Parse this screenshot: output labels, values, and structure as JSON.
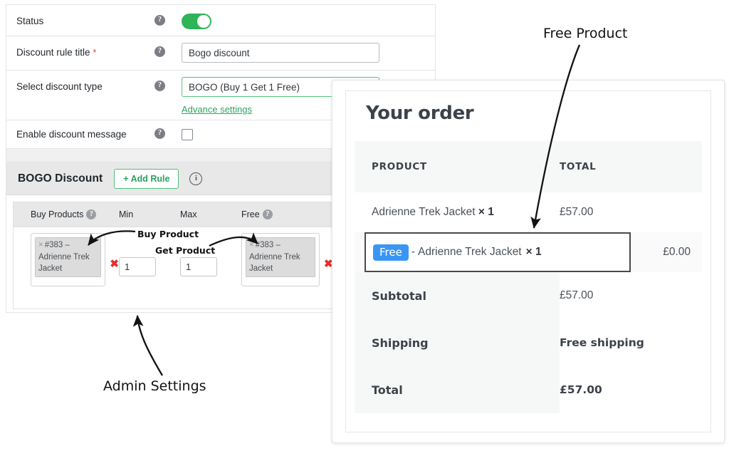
{
  "admin_form": {
    "rows": [
      {
        "label": "Status",
        "help": "?",
        "control": "toggle",
        "toggle_on": true
      },
      {
        "label": "Discount rule title",
        "required": true,
        "help": "?",
        "control": "text",
        "value": "Bogo discount"
      },
      {
        "label": "Select discount type",
        "help": "?",
        "control": "select",
        "value": "BOGO (Buy 1 Get 1 Free)",
        "link": "Advance settings"
      },
      {
        "label": "Enable discount message",
        "help": "?",
        "control": "checkbox",
        "checked": false
      }
    ]
  },
  "bogo": {
    "section_title": "BOGO Discount",
    "add_rule_label": "+ Add Rule",
    "info_icon": "info-icon",
    "columns": [
      "Buy Products",
      "Min",
      "Max",
      "Free"
    ],
    "rule": {
      "buy_product_tag": "#383 – Adrienne Trek Jacket",
      "buy_product_id": "#383 –",
      "buy_product_name": "Adrienne Trek Jacket",
      "min": "1",
      "max": "1",
      "free_product_id": "#383 –",
      "free_product_name": "Adrienne Trek Jacket",
      "remove_label": "✖"
    }
  },
  "order": {
    "title": "Your order",
    "columns": {
      "product": "PRODUCT",
      "total": "TOTAL"
    },
    "lines": [
      {
        "name": "Adrienne Trek Jacket",
        "qty": "× 1",
        "total": "£57.00",
        "free": false
      },
      {
        "badge": "Free",
        "prefix": "-",
        "name": "Adrienne Trek Jacket",
        "qty": "× 1",
        "total": "£0.00",
        "free": true
      }
    ],
    "totals": [
      {
        "label": "Subtotal",
        "value": "£57.00",
        "bold": false
      },
      {
        "label": "Shipping",
        "value": "Free shipping",
        "bold": true
      },
      {
        "label": "Total",
        "value": "£57.00",
        "bold": true
      }
    ]
  },
  "annotations": {
    "free_product": "Free Product",
    "admin_settings": "Admin Settings",
    "buy_product": "Buy Product",
    "get_product": "Get Product"
  },
  "colors": {
    "toggle_green": "#2fb457",
    "accent_green": "#29a35c",
    "free_badge_blue": "#3a96f3",
    "required_red": "#e2401c",
    "remove_red": "#e03131"
  }
}
